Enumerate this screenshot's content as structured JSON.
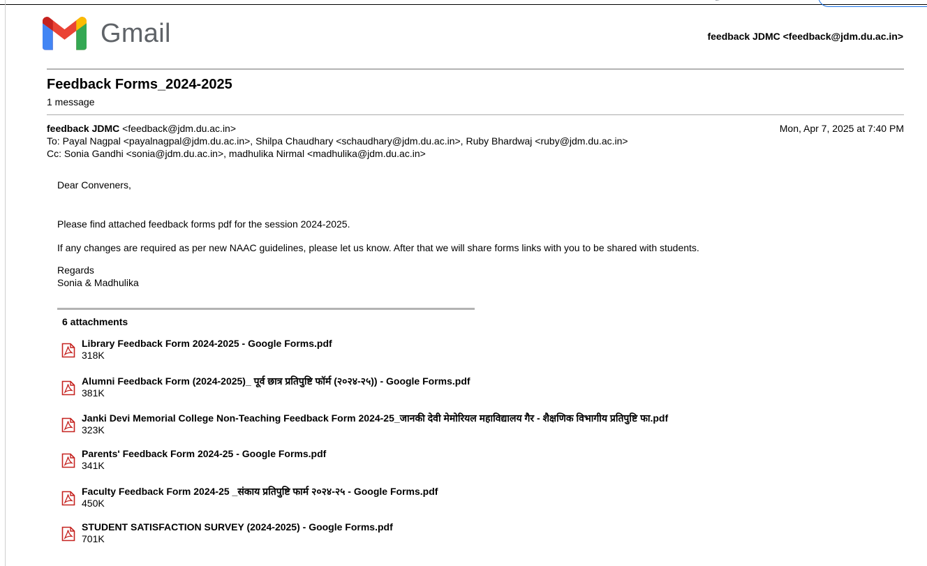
{
  "app": {
    "name": "Gmail",
    "account": "feedback JDMC <feedback@jdm.du.ac.in>"
  },
  "thread": {
    "subject": "Feedback Forms_2024-2025",
    "count": "1 message"
  },
  "message": {
    "from_name": "feedback JDMC",
    "from_email": "<feedback@jdm.du.ac.in>",
    "date": "Mon, Apr 7, 2025 at 7:40 PM",
    "to": "To: Payal Nagpal <payalnagpal@jdm.du.ac.in>, Shilpa Chaudhary <schaudhary@jdm.du.ac.in>, Ruby Bhardwaj <ruby@jdm.du.ac.in>",
    "cc": "Cc: Sonia Gandhi <sonia@jdm.du.ac.in>, madhulika Nirmal <madhulika@jdm.du.ac.in>",
    "greeting": "Dear Conveners,",
    "para1": "Please find attached feedback forms pdf for the session 2024-2025.",
    "para2": "If any changes are required as per new NAAC guidelines, please let us know. After that we will share forms links with you to be shared with students.",
    "closing": "Regards",
    "signature": "Sonia & Madhulika"
  },
  "attachments": {
    "title": "6 attachments",
    "items": [
      {
        "name": "Library Feedback Form 2024-2025 - Google Forms.pdf",
        "size": "318K"
      },
      {
        "name": "Alumni Feedback Form (2024-2025)_ पूर्व छात्र प्रतिपुष्टि फॉर्म (२०२४-२५)) - Google Forms.pdf",
        "size": "381K"
      },
      {
        "name": "Janki Devi Memorial College Non-Teaching Feedback Form 2024-25_जानकी देवी मेमोरियल महाविद्यालय गैर - शैक्षणिक विभागीय प्रतिपुष्टि फा.pdf",
        "size": "323K"
      },
      {
        "name": "Parents' Feedback Form 2024-25 - Google Forms.pdf",
        "size": "341K"
      },
      {
        "name": "Faculty Feedback Form 2024-25 _संकाय प्रतिपुष्टि फार्म २०२४-२५ - Google Forms.pdf",
        "size": "450K"
      },
      {
        "name": "STUDENT SATISFACTION SURVEY (2024-2025) - Google Forms.pdf",
        "size": "701K"
      }
    ]
  },
  "icons": {
    "logo": "gmail-logo-icon",
    "attachment": "pdf-file-icon"
  },
  "colors": {
    "pdf_red": "#c5221f",
    "logo_blue": "#4285f4",
    "logo_red": "#ea4335",
    "logo_green": "#34a853",
    "logo_yellow": "#fbbc04",
    "logo_darkred": "#c5221f"
  }
}
